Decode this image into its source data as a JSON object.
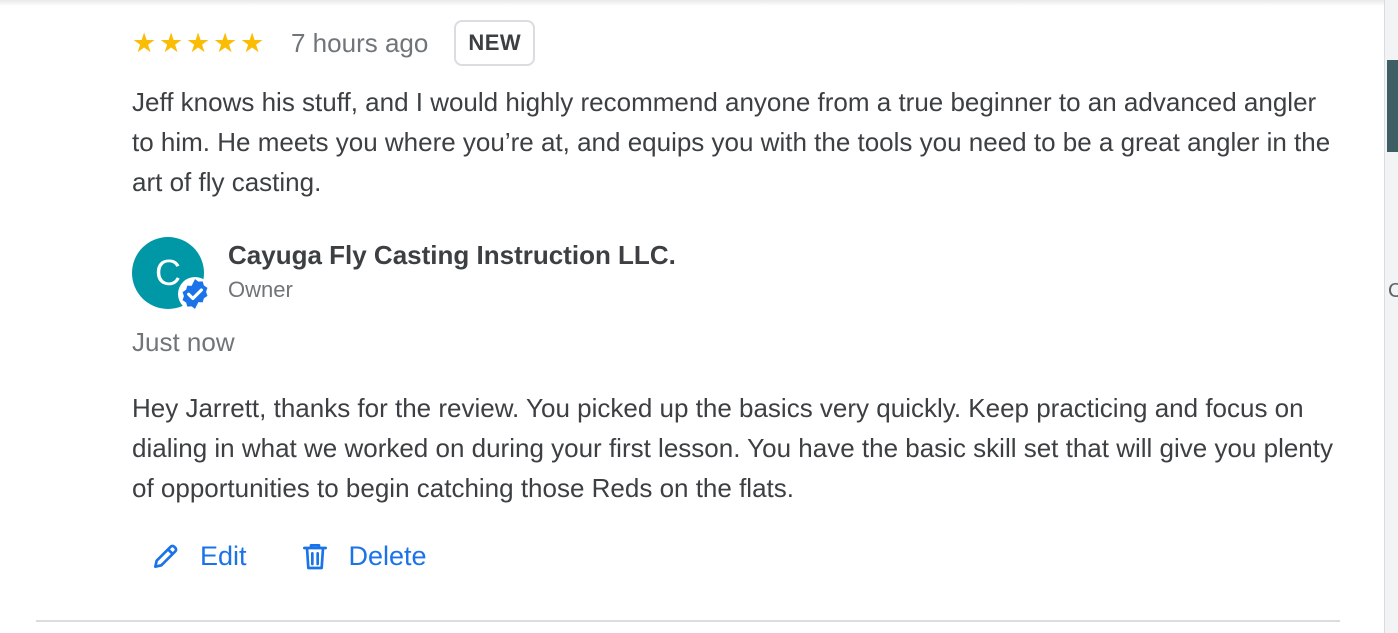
{
  "review": {
    "rating": 5,
    "stars": [
      "★",
      "★",
      "★",
      "★",
      "★"
    ],
    "time": "7 hours ago",
    "badge": "NEW",
    "text": "Jeff knows his stuff, and I would highly recommend anyone from a true beginner to an advanced angler to him. He meets you where you’re at, and equips you with the tools you need to be a great angler in the art of fly casting."
  },
  "owner": {
    "avatar_letter": "C",
    "name": "Cayuga Fly Casting Instruction LLC.",
    "role": "Owner",
    "verified_icon": "verified-badge-icon"
  },
  "reply": {
    "time": "Just now",
    "text": "Hey Jarrett, thanks for the review. You picked up the basics very quickly. Keep practicing and focus on dialing in what we worked on during your first lesson. You have the basic skill set that will give you plenty of opportunities to begin catching those Reds on the flats."
  },
  "actions": {
    "edit_label": "Edit",
    "delete_label": "Delete",
    "edit_icon": "pencil-icon",
    "delete_icon": "trash-icon"
  },
  "colors": {
    "star": "#fbbc04",
    "accent": "#1a73e8",
    "avatar": "#0097a7",
    "text": "#3c4043",
    "muted": "#70757a"
  }
}
